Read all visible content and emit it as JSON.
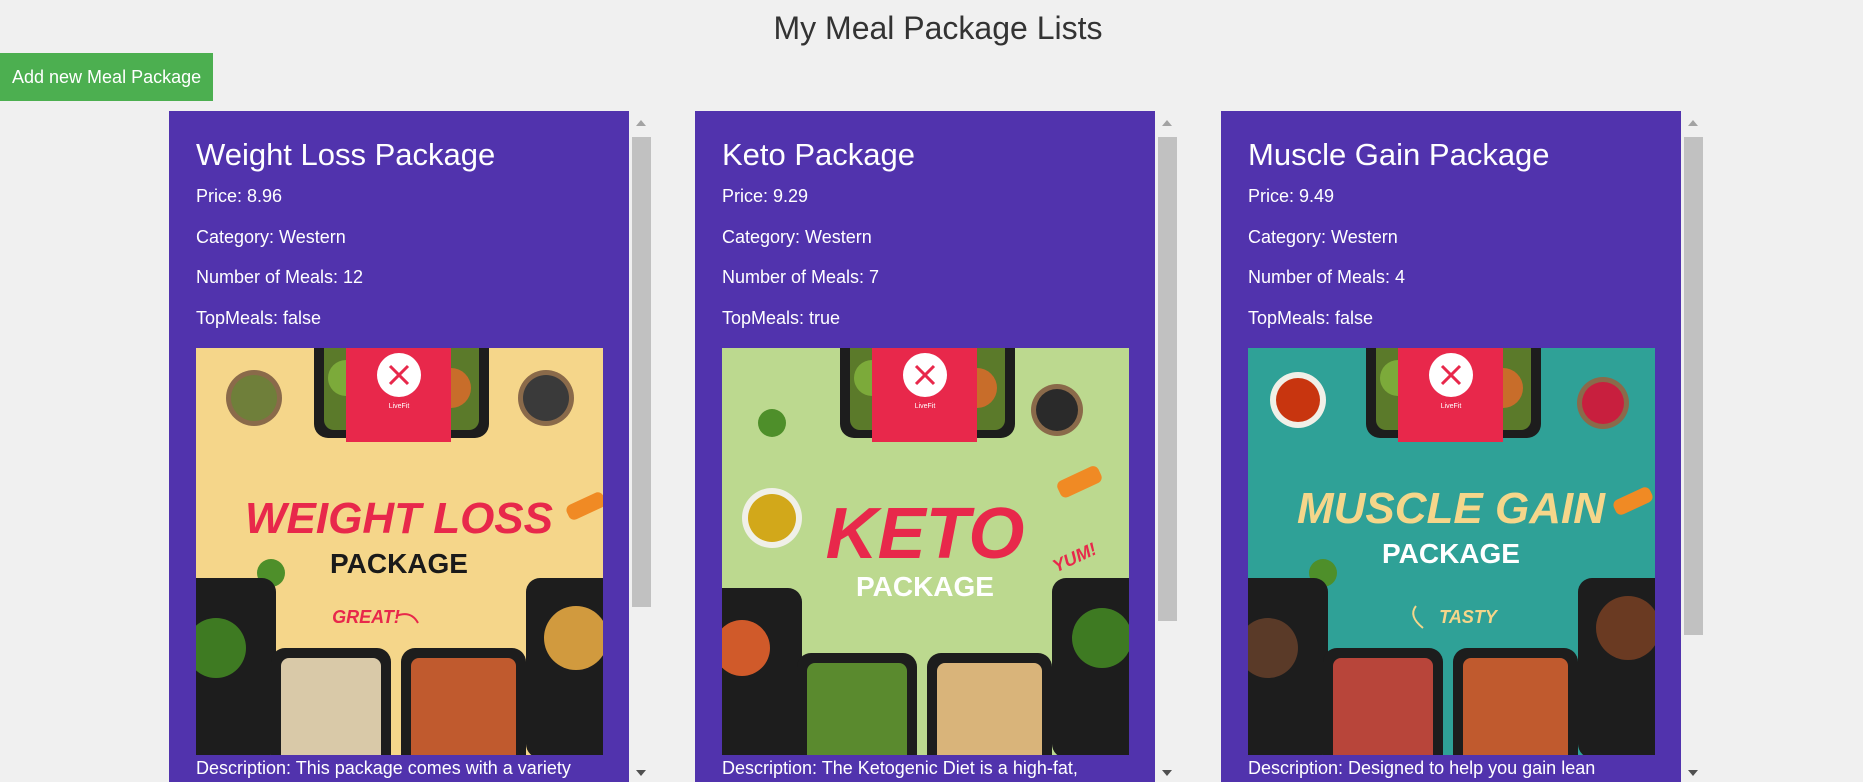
{
  "page": {
    "title": "My Meal Package Lists",
    "add_button": "Add new Meal Package"
  },
  "colors": {
    "card_bg": "#5133ad",
    "add_button_bg": "#4caf50",
    "page_bg": "#f0f0f0"
  },
  "packages": [
    {
      "name": "Weight Loss Package",
      "price": "Price: 8.96",
      "category": "Category: Western",
      "meals": "Number of Meals: 12",
      "topmeals": "TopMeals: false",
      "description": "Description: This package comes with a variety",
      "image": {
        "bg": "#f5d68a",
        "title1": "WEIGHT LOSS",
        "title2": "PACKAGE",
        "tag": "GREAT!",
        "logo": "LiveFit",
        "title1_color": "#e8284b",
        "title2_color": "#1a1a1a"
      }
    },
    {
      "name": "Keto Package",
      "price": "Price: 9.29",
      "category": "Category: Western",
      "meals": "Number of Meals: 7",
      "topmeals": "TopMeals: true",
      "description": "Description: The Ketogenic Diet is a high-fat,",
      "image": {
        "bg": "#bcd98f",
        "title1": "KETO",
        "title2": "PACKAGE",
        "tag": "YUM!",
        "logo": "LiveFit",
        "title1_color": "#e8284b",
        "title2_color": "#ffffff"
      }
    },
    {
      "name": "Muscle Gain Package",
      "price": "Price: 9.49",
      "category": "Category: Western",
      "meals": "Number of Meals: 4",
      "topmeals": "TopMeals: false",
      "description": "Description: Designed to help you gain lean",
      "image": {
        "bg": "#2fa197",
        "title1": "MUSCLE GAIN",
        "title2": "PACKAGE",
        "tag": "TASTY",
        "logo": "LiveFit",
        "title1_color": "#f5d68a",
        "title2_color": "#ffffff"
      }
    }
  ]
}
